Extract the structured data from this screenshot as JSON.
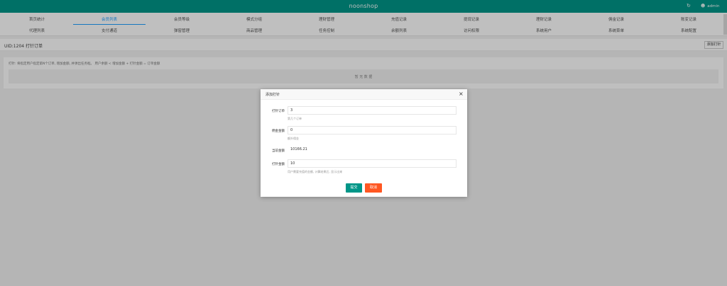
{
  "header": {
    "brand": "noonshop",
    "user": "admin"
  },
  "nav": {
    "row1": [
      "首页统计",
      "会员列表",
      "会员等级",
      "模式分组",
      "理财管理",
      "充值记录",
      "提现记录",
      "理财记录",
      "佣金记录",
      "账变记录"
    ],
    "row2": [
      "代理列表",
      "支付通道",
      "弹窗管理",
      "商品管理",
      "任务控制",
      "余额列表",
      "访问权限",
      "系统用户",
      "系统菜单",
      "系统配置"
    ],
    "active_index": 1
  },
  "page": {
    "title": "UID:1204 打针订单",
    "add_button": "添加打针"
  },
  "notice": "打针: 将指定用户指定第N个订单, 增加金额, 并弹出任务框。 用户余额 < 增加金额 + 打针金额 = 订单金额",
  "empty_state": "暂 无 数 据",
  "modal": {
    "title": "添加打针",
    "close": "×",
    "fields": [
      {
        "label": "打针订单",
        "value": "3",
        "hint": "第几个订单"
      },
      {
        "label": "佣金金额",
        "value": "0",
        "hint": "额外佣金"
      },
      {
        "label": "当前金额",
        "value": "10166.21"
      },
      {
        "label": "打针金额",
        "value": "10",
        "hint": "用户需要充值的金额, 计算结果后, 显示出来"
      }
    ],
    "submit": "提交",
    "cancel": "取消"
  }
}
